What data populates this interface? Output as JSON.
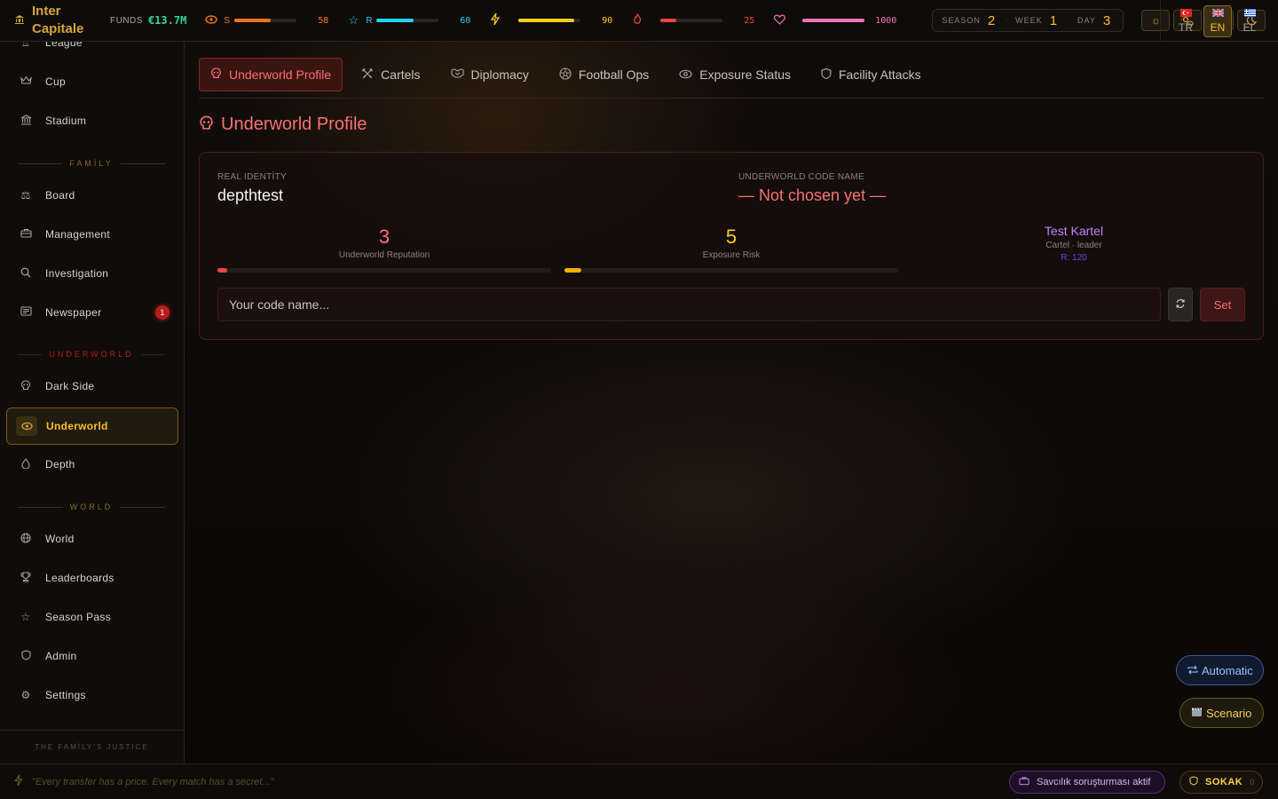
{
  "app": {
    "name_line1": "Inter",
    "name_line2": "Capitale"
  },
  "topbar": {
    "funds_label": "FUNDS",
    "funds_value": "€13.7M",
    "stats": [
      {
        "icon": "eye-icon",
        "code": "S",
        "value": "58",
        "fill": 0.58,
        "color": "#f97316"
      },
      {
        "icon": "star-icon",
        "code": "R",
        "value": "60",
        "fill": 0.6,
        "color": "#22d3ee"
      },
      {
        "icon": "lightning-icon",
        "code": "",
        "value": "90",
        "fill": 0.9,
        "color": "#facc15"
      },
      {
        "icon": "flame-icon",
        "code": "",
        "value": "25",
        "fill": 0.25,
        "color": "#ef4444"
      },
      {
        "icon": "heart-icon",
        "code": "",
        "value": "1000",
        "fill": 1.0,
        "color": "#f472b6"
      }
    ],
    "calendar": {
      "season_label": "SEASON",
      "season": "2",
      "week_label": "WEEK",
      "week": "1",
      "day_label": "DAY",
      "day": "3"
    },
    "languages": [
      {
        "code": "TR",
        "flag": "turkey-flag-icon",
        "active": false
      },
      {
        "code": "EN",
        "flag": "uk-flag-icon",
        "active": true
      },
      {
        "code": "EL",
        "flag": "greece-flag-icon",
        "active": false
      }
    ]
  },
  "sidebar": {
    "items": [
      {
        "label": "League",
        "icon": "trophy-icon"
      },
      {
        "label": "Cup",
        "icon": "crown-icon"
      },
      {
        "label": "Stadium",
        "icon": "building-icon"
      },
      {
        "label": "Board",
        "icon": "scales-icon"
      },
      {
        "label": "Management",
        "icon": "briefcase-icon"
      },
      {
        "label": "Investigation",
        "icon": "search-icon"
      },
      {
        "label": "Newspaper",
        "icon": "newspaper-icon",
        "badge": "1"
      },
      {
        "label": "Dark Side",
        "icon": "skull-icon"
      },
      {
        "label": "Underworld",
        "icon": "eye-icon",
        "active": true
      },
      {
        "label": "Depth",
        "icon": "droplet-icon"
      },
      {
        "label": "World",
        "icon": "globe-icon"
      },
      {
        "label": "Leaderboards",
        "icon": "trophy-icon"
      },
      {
        "label": "Season Pass",
        "icon": "star-icon"
      },
      {
        "label": "Admin",
        "icon": "shield-icon"
      },
      {
        "label": "Settings",
        "icon": "gear-icon"
      }
    ],
    "sections": {
      "family": "FAMİLY",
      "underworld": "UNDERWORLD",
      "world": "WORLD"
    },
    "footer": "THE FAMİLY'S JUSTICE"
  },
  "tabs": [
    {
      "label": "Underworld Profile",
      "icon": "skull-icon",
      "active": true
    },
    {
      "label": "Cartels",
      "icon": "crossed-swords-icon"
    },
    {
      "label": "Diplomacy",
      "icon": "handshake-icon"
    },
    {
      "label": "Football Ops",
      "icon": "football-icon"
    },
    {
      "label": "Exposure Status",
      "icon": "eye-icon"
    },
    {
      "label": "Facility Attacks",
      "icon": "shield-icon"
    }
  ],
  "profile": {
    "title": "Underworld Profile",
    "real_identity_label": "REAL IDENTİTY",
    "real_identity": "depthtest",
    "code_name_label": "UNDERWORLD CODE NAME",
    "code_name": "— Not chosen yet —",
    "reputation": {
      "value": "3",
      "label": "Underworld Reputation",
      "fill": 0.03,
      "color": "#ef4444"
    },
    "exposure": {
      "value": "5",
      "label": "Exposure Risk",
      "fill": 0.05,
      "color": "#eab308"
    },
    "cartel": {
      "name": "Test Kartel",
      "role": "Cartel · leader",
      "rep": "R: 120"
    },
    "input_placeholder": "Your code name...",
    "set_label": "Set"
  },
  "floating": {
    "automatic": "Automatic",
    "scenario": "Scenario"
  },
  "bottombar": {
    "quote": "\"Every transfer has a price. Every match has a secret...\"",
    "prosecution": "Savcılık soruşturması aktif",
    "street_label": "SOKAK",
    "street_count": "0"
  },
  "colors": {
    "accent_gold": "#d4a53a",
    "accent_red": "#f87171",
    "funds_green": "#34d399",
    "cartel_purple": "#c084fc"
  }
}
